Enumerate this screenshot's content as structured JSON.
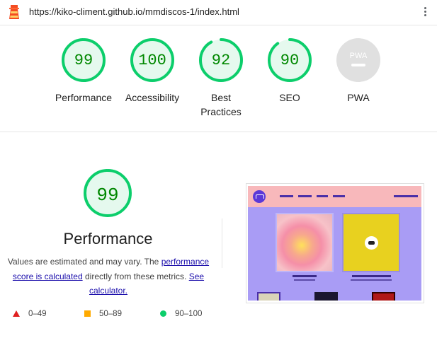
{
  "header": {
    "url": "https://kiko-climent.github.io/mmdiscos-1/index.html"
  },
  "categories": [
    {
      "label": "Performance",
      "score": "99",
      "value": 99,
      "color": "#0cce6b"
    },
    {
      "label": "Accessibility",
      "score": "100",
      "value": 100,
      "color": "#0cce6b"
    },
    {
      "label": "Best Practices",
      "score": "92",
      "value": 92,
      "color": "#0cce6b"
    },
    {
      "label": "SEO",
      "score": "90",
      "value": 90,
      "color": "#0cce6b"
    },
    {
      "label": "PWA",
      "badge_text": "PWA"
    }
  ],
  "performance": {
    "score": "99",
    "value": 99,
    "title": "Performance",
    "desc_part1": "Values are estimated and may vary. The",
    "link1": "performance score is calculated",
    "desc_part2": "directly from these metrics.",
    "link2": "See calculator."
  },
  "legend": {
    "fail": "0–49",
    "average": "50–89",
    "pass": "90–100"
  },
  "colors": {
    "pass": "#0cce6b",
    "pass_text": "#008800",
    "average": "#ffaa00",
    "fail": "#e02020",
    "link": "#1a0dab"
  }
}
